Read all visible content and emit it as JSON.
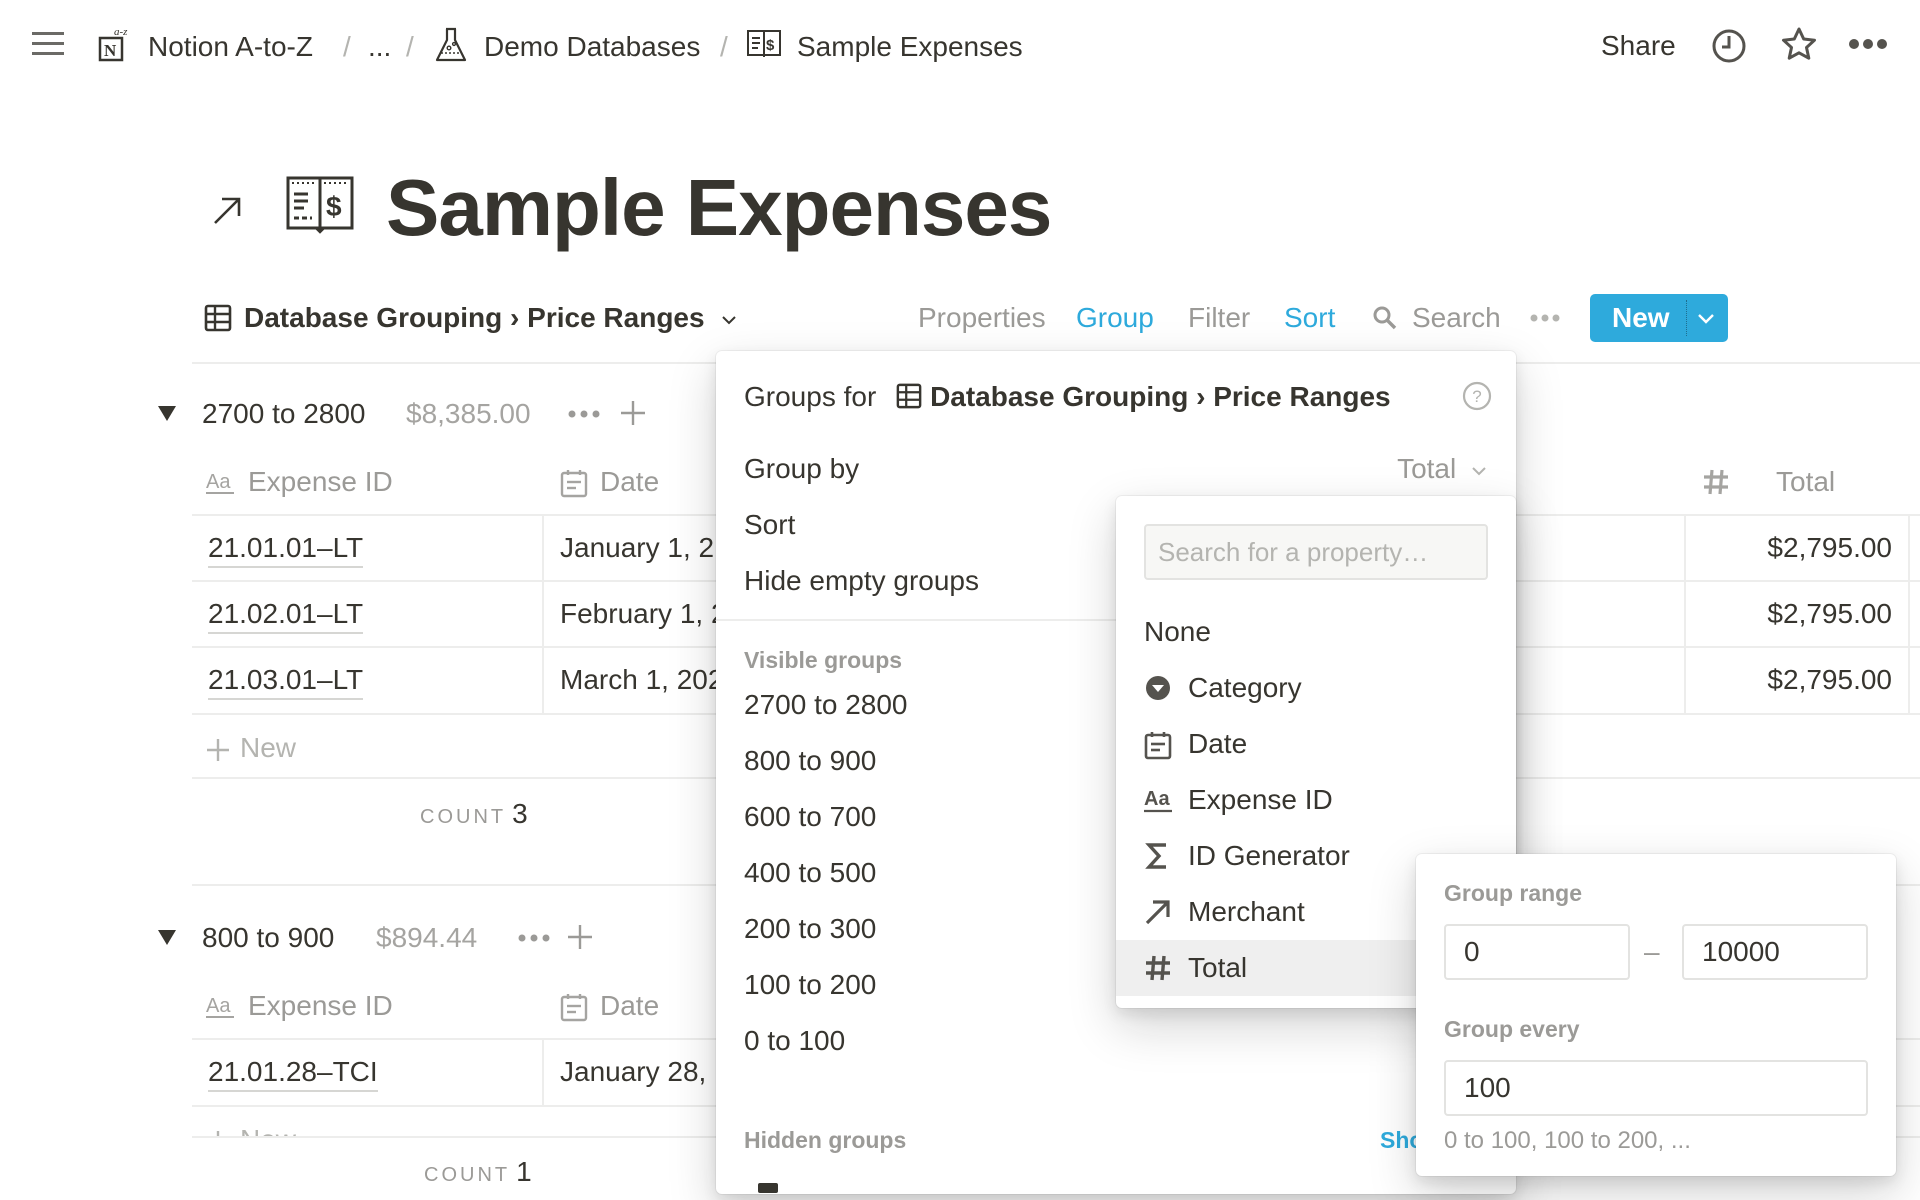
{
  "topbar": {
    "breadcrumbs": [
      {
        "label": "Notion A-to-Z",
        "icon": "notion-az-icon"
      },
      {
        "label": "..."
      },
      {
        "label": "Demo Databases",
        "icon": "flask-icon"
      },
      {
        "label": "Sample Expenses",
        "icon": "ledger-icon"
      }
    ],
    "separator": "/",
    "share_label": "Share",
    "actions": [
      "history-icon",
      "favorite-star-icon",
      "more-icon"
    ]
  },
  "page": {
    "title": "Sample Expenses",
    "icon": "ledger-icon",
    "backlink_icon": "arrow-up-right-icon"
  },
  "viewbar": {
    "view_name": "Database Grouping › Price Ranges",
    "properties_label": "Properties",
    "group_label": "Group",
    "filter_label": "Filter",
    "sort_label": "Sort",
    "search_label": "Search",
    "new_label": "New",
    "accent_color": "#2eaadc"
  },
  "table": {
    "columns": [
      "Expense ID",
      "Date",
      "Total"
    ],
    "groups": [
      {
        "title": "2700 to 2800",
        "sum": "$8,385.00",
        "rows": [
          {
            "id": "21.01.01–LT",
            "date": "January 1, 2",
            "total": "$2,795.00"
          },
          {
            "id": "21.02.01–LT",
            "date": "February 1, 2",
            "total": "$2,795.00"
          },
          {
            "id": "21.03.01–LT",
            "date": "March 1, 202",
            "total": "$2,795.00"
          }
        ],
        "new_label": "New",
        "count_label": "COUNT",
        "count": "3"
      },
      {
        "title": "800 to 900",
        "sum": "$894.44",
        "rows": [
          {
            "id": "21.01.28–TCI",
            "date": "January 28,"
          }
        ],
        "new_label": "New",
        "count_label": "COUNT",
        "count": "1"
      }
    ]
  },
  "groups_popover": {
    "header_prefix": "Groups for",
    "view_name": "Database Grouping › Price Ranges",
    "group_by_label": "Group by",
    "group_by_value": "Total",
    "sort_label": "Sort",
    "hide_empty_label": "Hide empty groups",
    "visible_groups_label": "Visible groups",
    "visible_groups": [
      "2700 to 2800",
      "800 to 900",
      "600 to 700",
      "400 to 500",
      "200 to 300",
      "100 to 200",
      "0 to 100"
    ],
    "hidden_groups_label": "Hidden groups",
    "show_label": "Sho"
  },
  "property_picker": {
    "search_placeholder": "Search for a property…",
    "search_value": "",
    "items": [
      {
        "label": "None",
        "icon": ""
      },
      {
        "label": "Category",
        "icon": "select-icon"
      },
      {
        "label": "Date",
        "icon": "calendar-icon"
      },
      {
        "label": "Expense ID",
        "icon": "text-title-icon"
      },
      {
        "label": "ID Generator",
        "icon": "formula-sigma-icon"
      },
      {
        "label": "Merchant",
        "icon": "relation-arrow-icon"
      },
      {
        "label": "Total",
        "icon": "number-hash-icon",
        "selected": true
      }
    ]
  },
  "range_popover": {
    "group_range_label": "Group range",
    "range_min": "0",
    "range_separator": "–",
    "range_max": "10000",
    "group_every_label": "Group every",
    "group_every": "100",
    "hint": "0 to 100, 100 to 200, ..."
  }
}
